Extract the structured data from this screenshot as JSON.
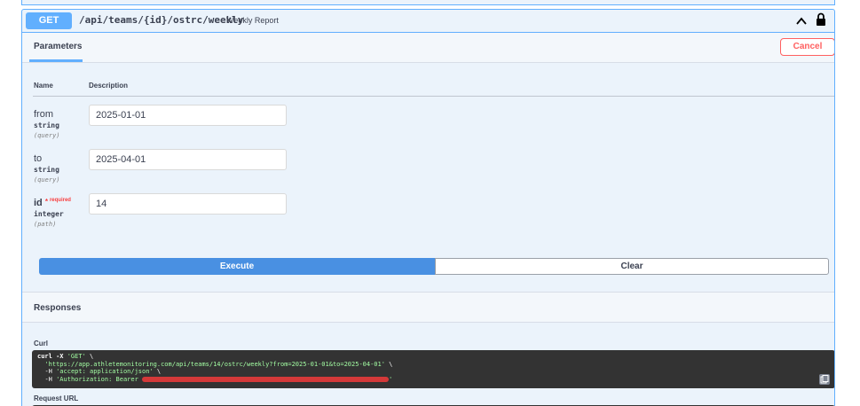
{
  "operation": {
    "method": "GET",
    "path": "/api/teams/{id}/ostrc/weekly",
    "summary": "Weekly Report"
  },
  "parameters_tab": {
    "title": "Parameters",
    "cancel_label": "Cancel",
    "col_name": "Name",
    "col_description": "Description",
    "items": [
      {
        "name": "from",
        "type": "string",
        "in": "(query)",
        "value": "2025-01-01",
        "required": false
      },
      {
        "name": "to",
        "type": "string",
        "in": "(query)",
        "value": "2025-04-01",
        "required": false
      },
      {
        "name": "id",
        "type": "integer",
        "in": "(path)",
        "value": "14",
        "required": true,
        "required_star": "*",
        "required_text": "required"
      }
    ]
  },
  "actions": {
    "execute_label": "Execute",
    "clear_label": "Clear"
  },
  "responses": {
    "title": "Responses",
    "curl_label": "Curl",
    "curl_line1_cmd": "curl -X ",
    "curl_line1_method": "'GET'",
    "curl_line1_tail": " \\",
    "curl_line2_url": "'https://app.athletemonitoring.com/api/teams/14/ostrc/weekly?from=2025-01-01&to=2025-04-01'",
    "curl_line2_tail": " \\",
    "curl_line3_flag": "-H ",
    "curl_line3_header": "'accept: application/json'",
    "curl_line3_tail": " \\",
    "curl_line4_flag": "-H ",
    "curl_line4_header": "'Authorization: Bearer ",
    "curl_line4_tail": "'",
    "request_url_label": "Request URL"
  },
  "colors": {
    "get_blue": "#61affe",
    "execute_blue": "#4990e2",
    "cancel_red": "#ff6060",
    "code_bg": "#333333"
  }
}
